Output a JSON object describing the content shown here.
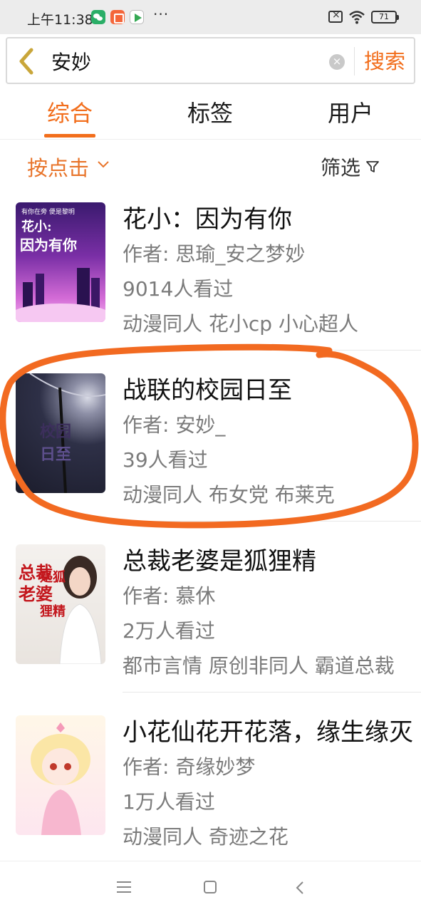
{
  "status_bar": {
    "time": "上午11:38",
    "battery": "71"
  },
  "search": {
    "query": "安妙",
    "clear_symbol": "×",
    "button_label": "搜索"
  },
  "tabs": [
    {
      "label": "综合"
    },
    {
      "label": "标签"
    },
    {
      "label": "用户"
    }
  ],
  "sort": {
    "label": "按点击",
    "filter_label": "筛选"
  },
  "colors": {
    "accent": "#f26e1c",
    "annotation": "#f26a21"
  },
  "books": [
    {
      "title": "花小：因为有你",
      "author": "作者: 思瑜_安之梦妙",
      "views": "9014人看过",
      "tags": "动漫同人 花小cp 小心超人",
      "cover_lines": [
        "花小:",
        "因为有你"
      ],
      "cover_caption": "有你在旁 便是黎明"
    },
    {
      "title": "战联的校园日至",
      "author": "作者: 安妙_",
      "views": "39人看过",
      "tags": "动漫同人 布女党 布莱克",
      "cover_lines": [
        "校园",
        "日至"
      ]
    },
    {
      "title": "总裁老婆是狐狸精",
      "author": "作者: 慕休",
      "views": "2万人看过",
      "tags": "都市言情 原创非同人 霸道总裁",
      "cover_lines": [
        "总裁",
        "老婆",
        "是狐",
        "狸精"
      ]
    },
    {
      "title": "小花仙花开花落，缘生缘灭",
      "author": "作者: 奇缘妙梦",
      "views": "1万人看过",
      "tags": "动漫同人 奇迹之花"
    }
  ]
}
